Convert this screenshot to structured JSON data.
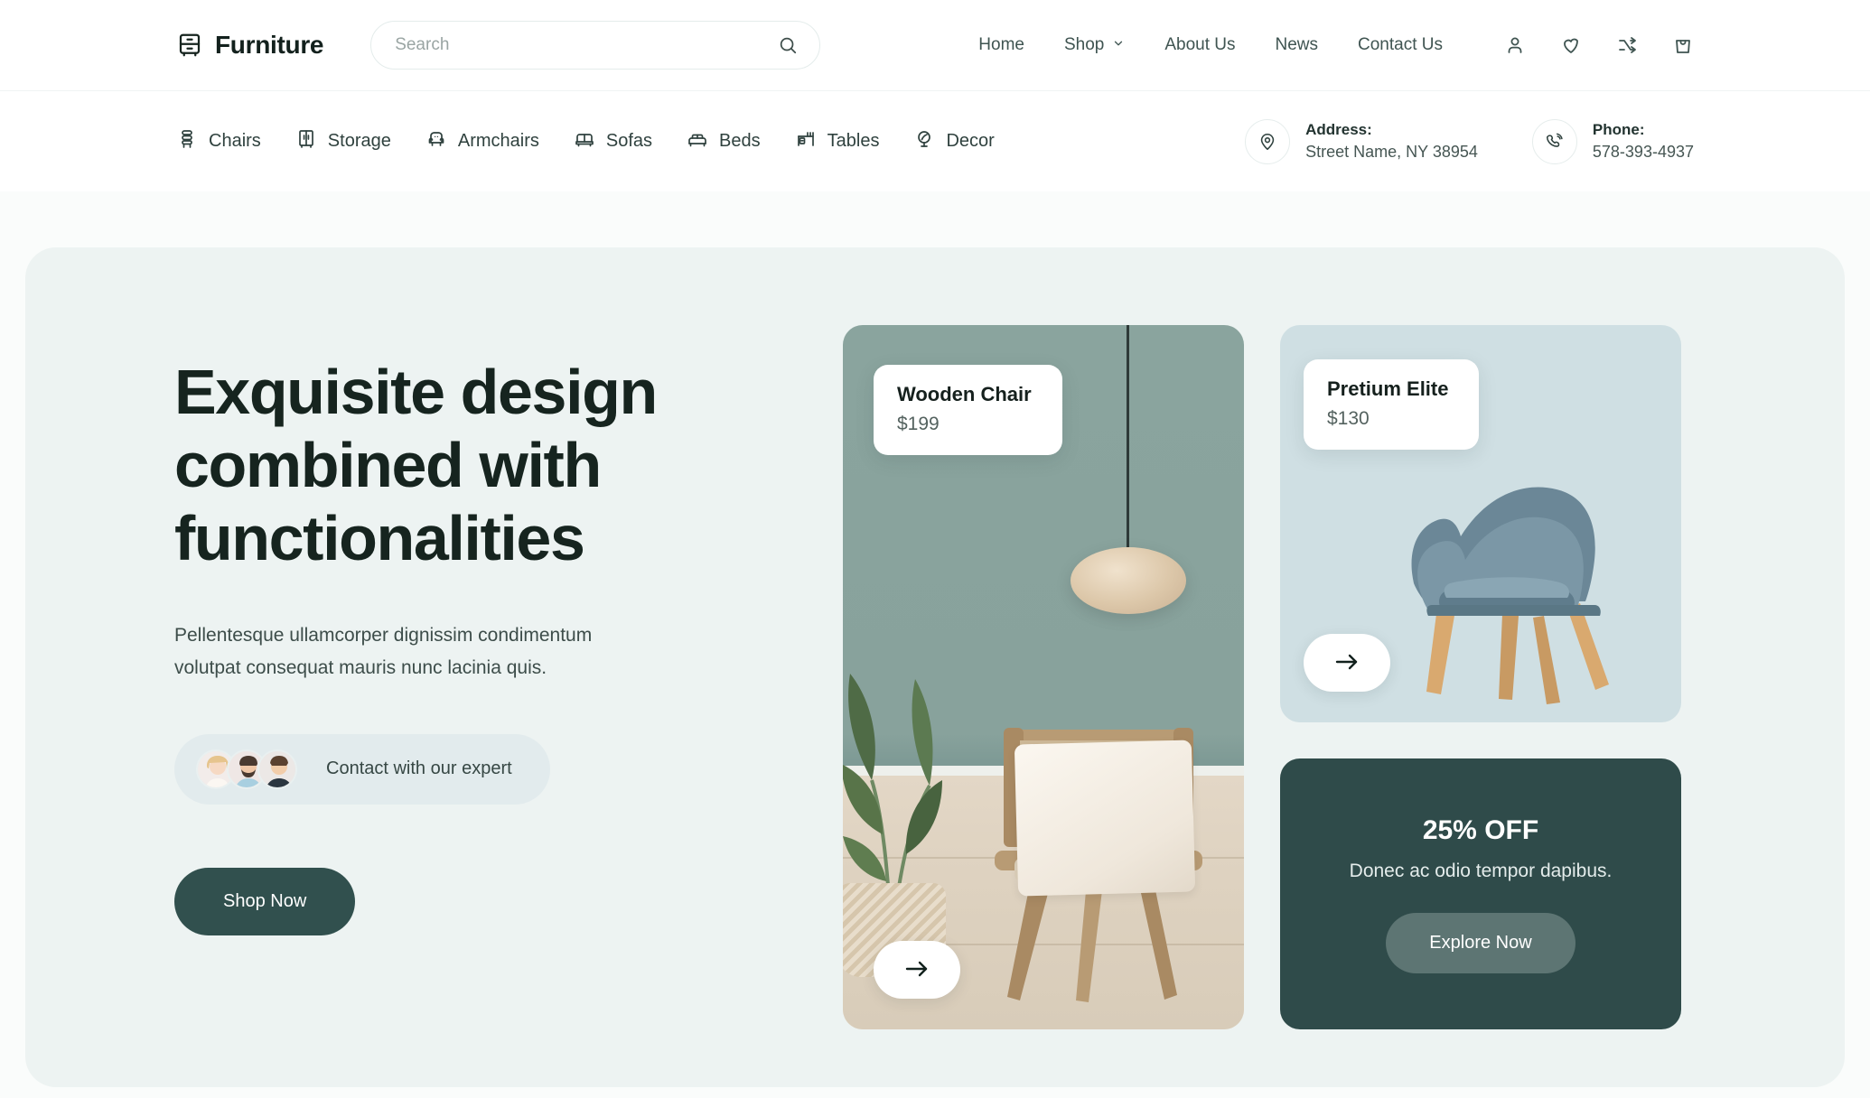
{
  "brand": {
    "name": "Furniture",
    "logo_icon": "dresser-logo-icon"
  },
  "search": {
    "placeholder": "Search",
    "value": "",
    "icon": "search-icon"
  },
  "nav": {
    "items": [
      {
        "label": "Home"
      },
      {
        "label": "Shop",
        "has_dropdown": true,
        "icon": "chevron-down-icon"
      },
      {
        "label": "About Us"
      },
      {
        "label": "News"
      },
      {
        "label": "Contact Us"
      }
    ],
    "icons": [
      {
        "name": "user-account-icon"
      },
      {
        "name": "heart-wishlist-icon"
      },
      {
        "name": "compare-shuffle-icon"
      },
      {
        "name": "shopping-bag-icon"
      }
    ]
  },
  "categories": [
    {
      "label": "Chairs",
      "icon": "chair-icon"
    },
    {
      "label": "Storage",
      "icon": "cabinet-icon"
    },
    {
      "label": "Armchairs",
      "icon": "armchair-icon"
    },
    {
      "label": "Sofas",
      "icon": "sofa-icon"
    },
    {
      "label": "Beds",
      "icon": "bed-icon"
    },
    {
      "label": "Tables",
      "icon": "table-icon"
    },
    {
      "label": "Decor",
      "icon": "mirror-decor-icon"
    }
  ],
  "contact": {
    "address": {
      "label": "Address:",
      "value": "Street Name, NY 38954",
      "icon": "location-pin-icon"
    },
    "phone": {
      "label": "Phone:",
      "value": "578-393-4937",
      "icon": "phone-ring-icon"
    }
  },
  "hero": {
    "title": "Exquisite design combined with functionalities",
    "subtitle": "Pellentesque ullamcorper dignissim condimentum volutpat consequat mauris nunc lacinia quis.",
    "expert_text": "Contact with our expert",
    "cta_label": "Shop Now"
  },
  "products": [
    {
      "name": "Wooden Chair",
      "price": "$199",
      "arrow_icon": "arrow-right-icon"
    },
    {
      "name": "Pretium Elite",
      "price": "$130",
      "arrow_icon": "arrow-right-icon"
    }
  ],
  "promo": {
    "title": "25% OFF",
    "subtitle": "Donec ac odio tempor dapibus.",
    "cta_label": "Explore Now"
  },
  "colors": {
    "page_bg": "#fafcfb",
    "hero_bg": "#edf3f2",
    "dark_teal": "#31504e",
    "promo_bg": "#2f4b4a",
    "promo_btn": "#5d7573",
    "product_card_bg": "#cfdfe3",
    "text_dark": "#16241f",
    "text_muted": "#3d4d4a"
  }
}
